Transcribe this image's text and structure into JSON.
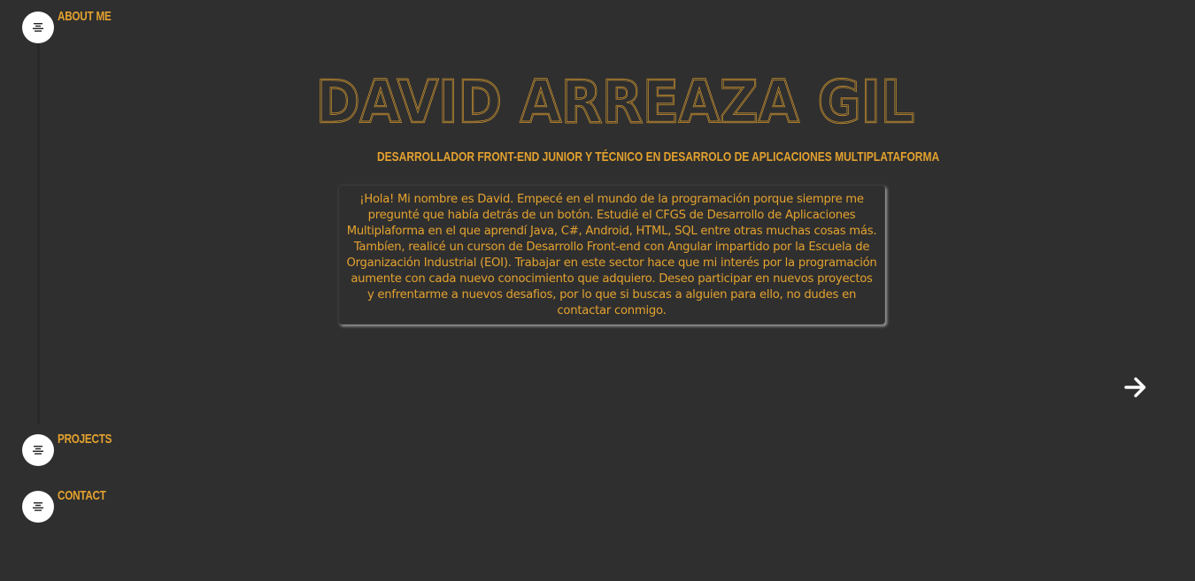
{
  "nav": {
    "items": [
      {
        "label": "ABOUT ME",
        "icon": "align-center-icon"
      },
      {
        "label": "PROJECTS",
        "icon": "align-center-icon"
      },
      {
        "label": "CONTACT",
        "icon": "align-center-icon"
      }
    ]
  },
  "hero": {
    "name": "DAVID ARREAZA GIL",
    "subtitle": "DESARROLLADOR FRONT-END JUNIOR Y TÉCNICO EN DESARROLO DE APLICACIONES MULTIPLATAFORMA",
    "bio": "¡Hola! Mi nombre es David. Empecé en el mundo de la programación porque siempre me pregunté que había detrás de un botón. Estudié el CFGS de Desarrollo de Aplicaciones Multiplaforma en el que aprendí Java, C#, Android, HTML, SQL entre otras muchas cosas más. Tambíen, realicé un curson de Desarrollo Front-end con Angular impartido por la Escuela de Organización Industrial (EOI). Trabajar en este sector hace que mi interés por la programación aumente con cada nuevo conocimiento que adquiero. Deseo participar en nuevos proyectos y enfrentarme a nuevos desafios, por lo que si buscas a alguien para ello, no dudes en contactar conmigo."
  },
  "next": {
    "icon": "arrow-right-icon"
  },
  "colors": {
    "background": "#2f2f2f",
    "accent": "#e4a22f",
    "nav_circle": "#ffffff"
  }
}
